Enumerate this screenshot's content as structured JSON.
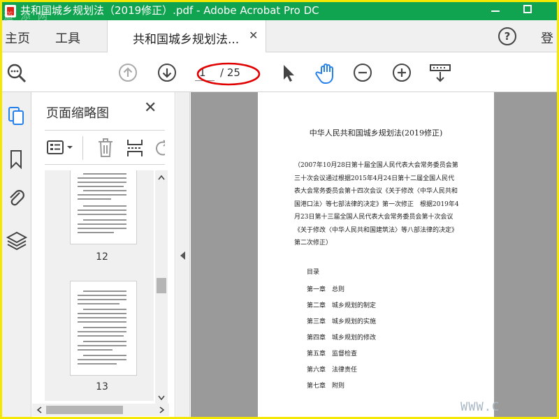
{
  "window": {
    "title": "共和国城乡规划法（2019修正）.pdf - Adobe Acrobat Pro DC"
  },
  "tabs": {
    "home": "主页",
    "tools": "工具",
    "document": "共和国城乡规划法...",
    "sign_in": "登"
  },
  "toolbar": {
    "current_page": "1",
    "total_pages": "/ 25",
    "icons": [
      "search-zoom-icon",
      "page-up-icon",
      "page-down-icon",
      "select-cursor-icon",
      "hand-icon",
      "zoom-out-icon",
      "zoom-in-icon",
      "scan-icon"
    ]
  },
  "left_nav": {
    "icons": [
      "page-thumbnails-icon",
      "bookmark-icon",
      "attachment-icon",
      "layers-icon"
    ]
  },
  "thumbnail_panel": {
    "title": "页面缩略图",
    "pages": [
      {
        "number": "12"
      },
      {
        "number": "13"
      }
    ]
  },
  "document": {
    "title": "中华人民共和国城乡规划法(2019修正)",
    "preamble": "（2007年10月28日第十届全国人民代表大会常务委员会第三十次会议通过根据2015年4月24日第十二届全国人民代表大会常务委员会第十四次会议《关于修改〈中华人民共和国港口法〉等七部法律的决定》第一次修正　根据2019年4月23日第十三届全国人民代表大会常务委员会第十次会议《关于修改〈中华人民共和国建筑法〉等八部法律的决定》第二次修正）",
    "toc_heading": "目录",
    "toc": [
      {
        "chapter": "第一章",
        "name": "总则"
      },
      {
        "chapter": "第二章",
        "name": "城乡规划的制定"
      },
      {
        "chapter": "第三章",
        "name": "城乡规划的实施"
      },
      {
        "chapter": "第四章",
        "name": "城乡规划的修改"
      },
      {
        "chapter": "第五章",
        "name": "监督检查"
      },
      {
        "chapter": "第六章",
        "name": "法律责任"
      },
      {
        "chapter": "第七章",
        "name": "附则"
      }
    ]
  },
  "watermark": {
    "logo": "道 添 网",
    "url": "WWW.C"
  },
  "colors": {
    "titlebar": "#10a350",
    "frame": "#f5e800",
    "annotation": "#e00000",
    "hand_tool": "#2680eb"
  }
}
